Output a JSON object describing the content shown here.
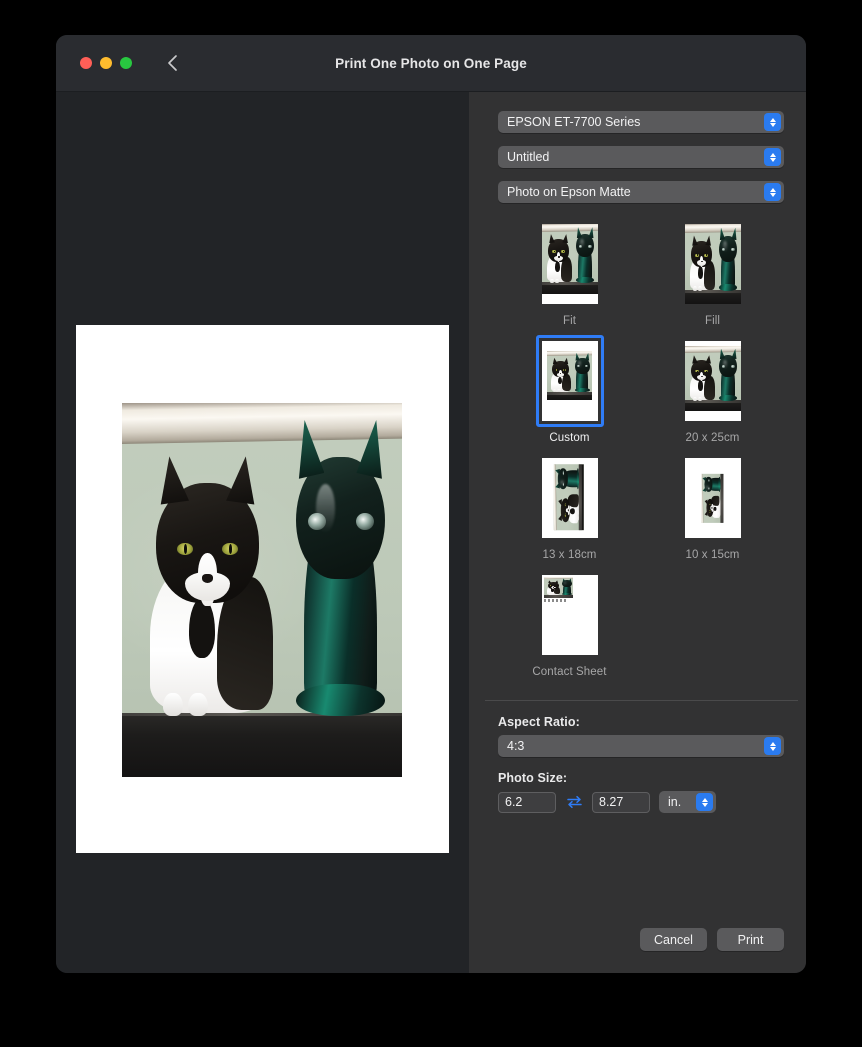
{
  "window": {
    "title": "Print One Photo on One Page",
    "back_icon": "chevron-left-icon",
    "traffic_lights": {
      "close": "close-window-button",
      "minimize": "minimize-window-button",
      "zoom": "zoom-window-button"
    }
  },
  "sidebar": {
    "printer": {
      "value": "EPSON ET-7700 Series",
      "icon": "stepper-arrows-icon"
    },
    "preset": {
      "value": "Untitled",
      "icon": "stepper-arrows-icon"
    },
    "paper_type": {
      "value": "Photo on Epson Matte",
      "icon": "stepper-arrows-icon"
    },
    "layout_presets": [
      {
        "label": "Fit",
        "selected": false,
        "variant": "fit"
      },
      {
        "label": "Fill",
        "selected": false,
        "variant": "fill"
      },
      {
        "label": "Custom",
        "selected": true,
        "variant": "custom"
      },
      {
        "label": "20 x 25cm",
        "selected": false,
        "variant": "size20"
      },
      {
        "label": "13 x 18cm",
        "selected": false,
        "variant": "size13"
      },
      {
        "label": "10 x 15cm",
        "selected": false,
        "variant": "size10"
      },
      {
        "label": "Contact Sheet",
        "selected": false,
        "variant": "contact"
      }
    ],
    "aspect_ratio": {
      "label": "Aspect Ratio:",
      "value": "4:3"
    },
    "photo_size": {
      "label": "Photo Size:",
      "width": "6.2",
      "height": "8.27",
      "unit": "in.",
      "swap_icon": "swap-dimensions-icon"
    },
    "buttons": {
      "cancel": "Cancel",
      "print": "Print"
    }
  },
  "preview": {
    "description": "Tuxedo cat beside a teal ceramic cat figurine on a dark table"
  },
  "colors": {
    "accent": "#2a7bf0",
    "selection": "#2f7cf6",
    "titlebar": "#2a2c30",
    "preview_pane": "#222427",
    "sidebar": "#323233",
    "control": "#5a5a5c"
  }
}
